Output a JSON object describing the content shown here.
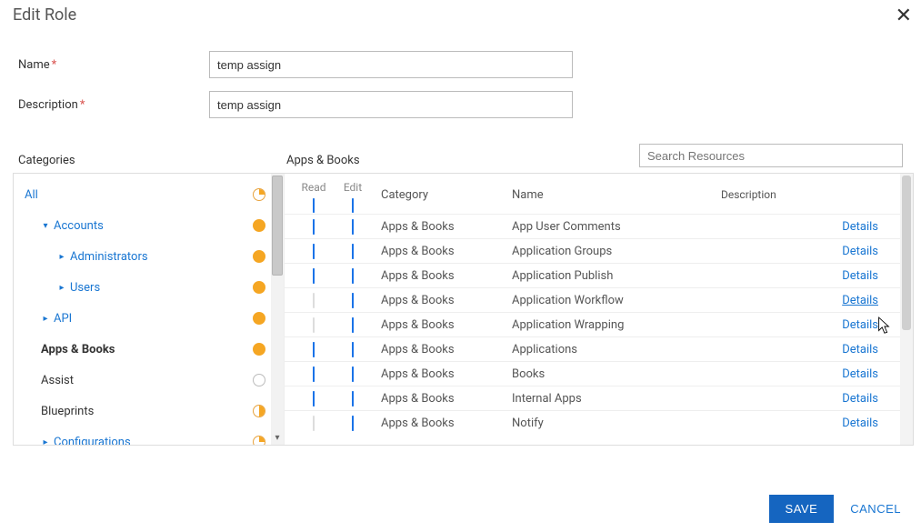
{
  "header": {
    "title": "Edit Role"
  },
  "form": {
    "name_label": "Name",
    "name_value": "temp assign",
    "desc_label": "Description",
    "desc_value": "temp assign"
  },
  "sections": {
    "categories_label": "Categories",
    "table_label": "Apps & Books",
    "search_placeholder": "Search Resources"
  },
  "tree": [
    {
      "label": "All",
      "indent": 0,
      "caret": "",
      "dot": "quarter",
      "style": "link"
    },
    {
      "label": "Accounts",
      "indent": 1,
      "caret": "down",
      "dot": "full",
      "style": "link"
    },
    {
      "label": "Administrators",
      "indent": 2,
      "caret": "right",
      "dot": "full",
      "style": "link"
    },
    {
      "label": "Users",
      "indent": 2,
      "caret": "right",
      "dot": "full",
      "style": "link"
    },
    {
      "label": "API",
      "indent": 1,
      "caret": "right",
      "dot": "full",
      "style": "link"
    },
    {
      "label": "Apps & Books",
      "indent": 1,
      "caret": "",
      "dot": "full",
      "style": "bold"
    },
    {
      "label": "Assist",
      "indent": 1,
      "caret": "",
      "dot": "empty",
      "style": "plain"
    },
    {
      "label": "Blueprints",
      "indent": 1,
      "caret": "",
      "dot": "half",
      "style": "plain"
    },
    {
      "label": "Configurations",
      "indent": 1,
      "caret": "right",
      "dot": "quarter",
      "style": "link"
    }
  ],
  "table": {
    "headers": {
      "read": "Read",
      "edit": "Edit",
      "category": "Category",
      "name": "Name",
      "description": "Description"
    },
    "details_label": "Details",
    "rows": [
      {
        "read": "checked",
        "edit": "checked",
        "category": "Apps & Books",
        "name": "App User Comments"
      },
      {
        "read": "checked",
        "edit": "checked",
        "category": "Apps & Books",
        "name": "Application Groups"
      },
      {
        "read": "checked",
        "edit": "checked",
        "category": "Apps & Books",
        "name": "Application Publish"
      },
      {
        "read": "dim",
        "edit": "checked",
        "category": "Apps & Books",
        "name": "Application Workflow",
        "hover": true
      },
      {
        "read": "dim",
        "edit": "checked",
        "category": "Apps & Books",
        "name": "Application Wrapping"
      },
      {
        "read": "checked",
        "edit": "checked",
        "category": "Apps & Books",
        "name": "Applications"
      },
      {
        "read": "checked",
        "edit": "checked",
        "category": "Apps & Books",
        "name": "Books"
      },
      {
        "read": "checked",
        "edit": "checked",
        "category": "Apps & Books",
        "name": "Internal Apps"
      },
      {
        "read": "dim",
        "edit": "checked",
        "category": "Apps & Books",
        "name": "Notify"
      }
    ]
  },
  "footer": {
    "save": "SAVE",
    "cancel": "CANCEL"
  }
}
